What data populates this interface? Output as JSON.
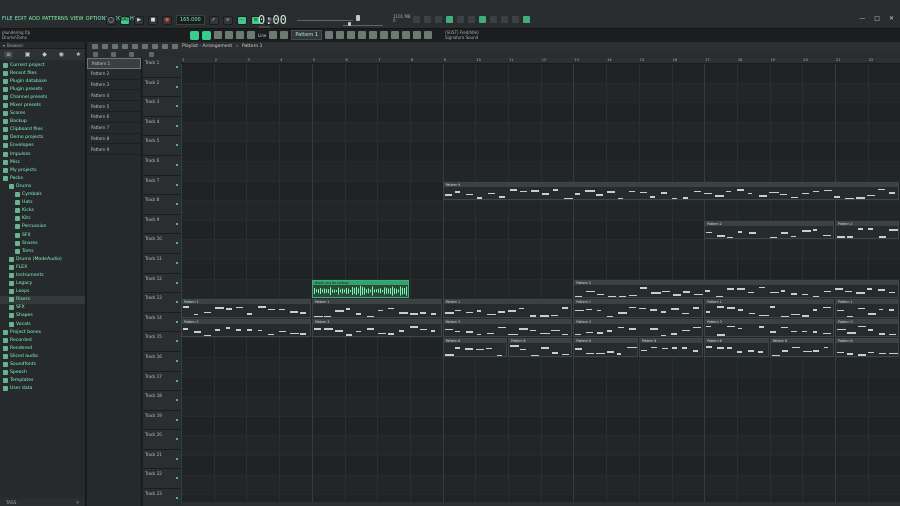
{
  "menu": [
    "FILE",
    "EDIT",
    "ADD",
    "PATTERNS",
    "VIEW",
    "OPTIONS",
    "TOOLS",
    "HELP"
  ],
  "transport": {
    "mode": "PAT",
    "tempo": "165.000",
    "time": "0:00",
    "time_label": "M:S:CS",
    "pattern": "Pattern 1",
    "snap": "Line",
    "monitor_lines": [
      "1101 MB",
      "0"
    ]
  },
  "hint_left": [
    "plundering f/p",
    "Drums\\Toms"
  ],
  "hint_right": [
    "(SUST) Fred/Idle]",
    "Signature Sound"
  ],
  "browser": {
    "title": "Browser",
    "footer_left": "TAGS",
    "items": [
      {
        "label": "Current project",
        "indent": 0
      },
      {
        "label": "Recent files",
        "indent": 0
      },
      {
        "label": "Plugin database",
        "indent": 0
      },
      {
        "label": "Plugin presets",
        "indent": 0
      },
      {
        "label": "Channel presets",
        "indent": 0
      },
      {
        "label": "Mixer presets",
        "indent": 0
      },
      {
        "label": "Scores",
        "indent": 0
      },
      {
        "label": "Backup",
        "indent": 0
      },
      {
        "label": "Clipboard files",
        "indent": 0
      },
      {
        "label": "Demo projects",
        "indent": 0
      },
      {
        "label": "Envelopes",
        "indent": 0
      },
      {
        "label": "Impulses",
        "indent": 0
      },
      {
        "label": "Misc",
        "indent": 0
      },
      {
        "label": "My projects",
        "indent": 0
      },
      {
        "label": "Packs",
        "indent": 0
      },
      {
        "label": "Drums",
        "indent": 1
      },
      {
        "label": "Cymbals",
        "indent": 2
      },
      {
        "label": "Hats",
        "indent": 2
      },
      {
        "label": "Kicks",
        "indent": 2
      },
      {
        "label": "Kits",
        "indent": 2
      },
      {
        "label": "Percussion",
        "indent": 2
      },
      {
        "label": "SFX",
        "indent": 2
      },
      {
        "label": "Snares",
        "indent": 2
      },
      {
        "label": "Toms",
        "indent": 2
      },
      {
        "label": "Drums (ModeAudio)",
        "indent": 1
      },
      {
        "label": "FLEX",
        "indent": 1
      },
      {
        "label": "Instruments",
        "indent": 1
      },
      {
        "label": "Legacy",
        "indent": 1
      },
      {
        "label": "Loops",
        "indent": 1
      },
      {
        "label": "Risers",
        "indent": 1
      },
      {
        "label": "SFX",
        "indent": 1
      },
      {
        "label": "Shapes",
        "indent": 1
      },
      {
        "label": "Vocals",
        "indent": 1
      },
      {
        "label": "Project bones",
        "indent": 0
      },
      {
        "label": "Recorded",
        "indent": 0
      },
      {
        "label": "Rendered",
        "indent": 0
      },
      {
        "label": "Sliced audio",
        "indent": 0
      },
      {
        "label": "Soundfonts",
        "indent": 0
      },
      {
        "label": "Speech",
        "indent": 0
      },
      {
        "label": "Templates",
        "indent": 0
      },
      {
        "label": "User data",
        "indent": 0
      }
    ]
  },
  "playlist": {
    "title": "Playlist - Arrangement",
    "sep": "›",
    "current": "Pattern 1",
    "patterns": [
      "Pattern 1",
      "Pattern 2",
      "Pattern 3",
      "Pattern 4",
      "Pattern 5",
      "Pattern 6",
      "Pattern 7",
      "Pattern 8",
      "Pattern 9"
    ],
    "ruler": [
      "1",
      "2",
      "3",
      "4",
      "5",
      "6",
      "7",
      "8",
      "9",
      "10",
      "11",
      "12",
      "13",
      "14",
      "15",
      "16",
      "17",
      "18",
      "19",
      "20",
      "21",
      "22"
    ],
    "tracks": [
      "Track 1",
      "Track 2",
      "Track 3",
      "Track 4",
      "Track 5",
      "Track 6",
      "Track 7",
      "Track 8",
      "Track 9",
      "Track 10",
      "Track 11",
      "Track 12",
      "Track 13",
      "Track 14",
      "Track 15",
      "Track 16",
      "Track 17",
      "Track 18",
      "Track 19",
      "Track 20",
      "Track 21",
      "Track 22",
      "Track 23"
    ],
    "clips": [
      {
        "track": 7,
        "start": 9,
        "len": 14,
        "label": "Pattern 9",
        "type": "pattern"
      },
      {
        "track": 9,
        "start": 17,
        "len": 4,
        "label": "Pattern 2",
        "type": "pattern"
      },
      {
        "track": 9,
        "start": 21,
        "len": 2,
        "label": "Pattern 2",
        "type": "pattern"
      },
      {
        "track": 12,
        "start": 5,
        "len": 3,
        "label": "thank you for calling!",
        "type": "audio"
      },
      {
        "track": 12,
        "start": 13,
        "len": 10,
        "label": "Pattern 5",
        "type": "pattern"
      },
      {
        "track": 13,
        "start": 1,
        "len": 4,
        "label": "Pattern 1",
        "type": "pattern"
      },
      {
        "track": 13,
        "start": 5,
        "len": 4,
        "label": "Pattern 1",
        "type": "pattern"
      },
      {
        "track": 13,
        "start": 9,
        "len": 4,
        "label": "Pattern 1",
        "type": "pattern"
      },
      {
        "track": 13,
        "start": 13,
        "len": 4,
        "label": "Pattern 1",
        "type": "pattern"
      },
      {
        "track": 13,
        "start": 17,
        "len": 4,
        "label": "Pattern 1",
        "type": "pattern"
      },
      {
        "track": 13,
        "start": 21,
        "len": 2,
        "label": "Pattern 1",
        "type": "pattern"
      },
      {
        "track": 14,
        "start": 1,
        "len": 4,
        "label": "Pattern 3",
        "type": "pattern"
      },
      {
        "track": 14,
        "start": 5,
        "len": 4,
        "label": "Pattern 3",
        "type": "pattern"
      },
      {
        "track": 14,
        "start": 9,
        "len": 4,
        "label": "Pattern 3",
        "type": "pattern"
      },
      {
        "track": 14,
        "start": 13,
        "len": 4,
        "label": "Pattern 3",
        "type": "pattern"
      },
      {
        "track": 14,
        "start": 17,
        "len": 4,
        "label": "Pattern 3",
        "type": "pattern"
      },
      {
        "track": 14,
        "start": 21,
        "len": 2,
        "label": "Pattern 3",
        "type": "pattern"
      },
      {
        "track": 15,
        "start": 9,
        "len": 2,
        "label": "Pattern 6",
        "type": "pattern"
      },
      {
        "track": 15,
        "start": 11,
        "len": 2,
        "label": "Pattern 6",
        "type": "pattern"
      },
      {
        "track": 15,
        "start": 13,
        "len": 2,
        "label": "Pattern 6",
        "type": "pattern"
      },
      {
        "track": 15,
        "start": 15,
        "len": 2,
        "label": "Pattern 6",
        "type": "pattern"
      },
      {
        "track": 15,
        "start": 17,
        "len": 2,
        "label": "Pattern 6",
        "type": "pattern"
      },
      {
        "track": 15,
        "start": 19,
        "len": 2,
        "label": "Pattern 6",
        "type": "pattern"
      },
      {
        "track": 15,
        "start": 21,
        "len": 2,
        "label": "Pattern 6",
        "type": "pattern"
      }
    ]
  },
  "colors": {
    "accent": "#36ce8b",
    "text_green": "#7df5b6",
    "bg": "#1b1d1e"
  }
}
